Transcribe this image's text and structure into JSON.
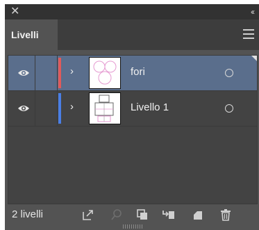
{
  "panel": {
    "title_icons": {
      "close": "close-icon",
      "collapse": "collapse-icon"
    },
    "tab_label": "Livelli",
    "menu_icon": "hamburger-menu-icon"
  },
  "layers": [
    {
      "name": "fori",
      "color": "#e05a5a",
      "visible": true,
      "selected": true
    },
    {
      "name": "Livello 1",
      "color": "#4a7fe6",
      "visible": true,
      "selected": false
    }
  ],
  "footer": {
    "count": "2 livelli",
    "icons": [
      "export-icon",
      "search-icon",
      "clipping-mask-icon",
      "new-sublayer-icon",
      "new-layer-icon",
      "trash-icon"
    ]
  },
  "colors": {
    "panel_bg": "#535353",
    "selection": "#5a6e8c"
  }
}
